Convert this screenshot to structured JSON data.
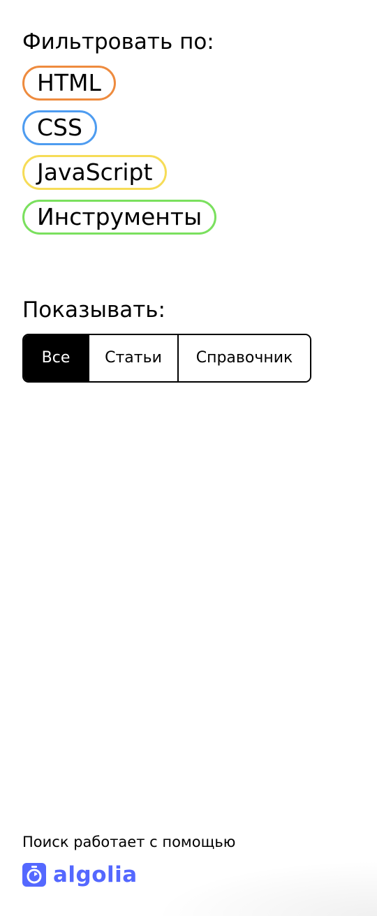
{
  "filters": {
    "title": "Фильтровать по:",
    "chips": [
      {
        "label": "HTML",
        "color": "#ee8b3e"
      },
      {
        "label": "CSS",
        "color": "#4e9cf0"
      },
      {
        "label": "JavaScript",
        "color": "#f6dc57"
      },
      {
        "label": "Инструменты",
        "color": "#7ae05e"
      }
    ]
  },
  "show": {
    "title": "Показывать:",
    "options": [
      {
        "label": "Все",
        "selected": true
      },
      {
        "label": "Статьи",
        "selected": false
      },
      {
        "label": "Справочник",
        "selected": false
      }
    ]
  },
  "footer": {
    "powered_text": "Поиск работает с помощью",
    "brand": "algolia",
    "brand_color": "#5468ff",
    "brand_icon": "algolia-stopwatch-icon"
  }
}
